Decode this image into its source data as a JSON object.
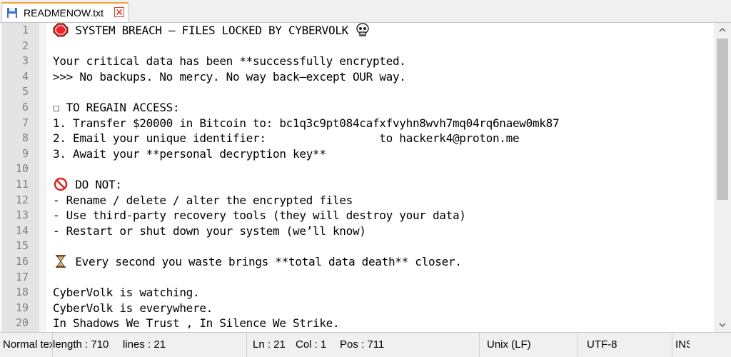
{
  "tab": {
    "filename": "READMENOW.txt",
    "icon": "save-floppy-icon",
    "close_icon": "close-icon"
  },
  "editor": {
    "lines": [
      {
        "n": "1",
        "icon": "stop-sign-icon",
        "text": " SYSTEM BREACH — FILES LOCKED BY CYBERVOLK ",
        "icon_after": "skull-icon"
      },
      {
        "n": "2",
        "text": ""
      },
      {
        "n": "3",
        "text": "Your critical data has been **successfully encrypted."
      },
      {
        "n": "4",
        "text": ">>> No backups. No mercy. No way back—except OUR way."
      },
      {
        "n": "5",
        "text": ""
      },
      {
        "n": "6",
        "text": "☐ TO REGAIN ACCESS:"
      },
      {
        "n": "7",
        "text": "1. Transfer $20000 in Bitcoin to: bc1q3c9pt084cafxfvyhn8wvh7mq04rq6naew0mk87"
      },
      {
        "n": "8",
        "text": "2. Email your unique identifier:                 to hackerk4@proton.me"
      },
      {
        "n": "9",
        "text": "3. Await your **personal decryption key**"
      },
      {
        "n": "10",
        "text": ""
      },
      {
        "n": "11",
        "icon": "prohibited-icon",
        "text": " DO NOT:"
      },
      {
        "n": "12",
        "text": "- Rename / delete / alter the encrypted files"
      },
      {
        "n": "13",
        "text": "- Use third-party recovery tools (they will destroy your data)"
      },
      {
        "n": "14",
        "text": "- Restart or shut down your system (we’ll know)"
      },
      {
        "n": "15",
        "text": ""
      },
      {
        "n": "16",
        "icon": "hourglass-icon",
        "text": " Every second you waste brings **total data death** closer."
      },
      {
        "n": "17",
        "text": ""
      },
      {
        "n": "18",
        "text": "CyberVolk is watching."
      },
      {
        "n": "19",
        "text": "CyberVolk is everywhere."
      },
      {
        "n": "20",
        "text": "In Shadows We Trust , In Silence We Strike."
      }
    ]
  },
  "status": {
    "doc_type": "Normal text file",
    "length": "length : 710",
    "lines": "lines : 21",
    "ln": "Ln : 21",
    "col": "Col : 1",
    "pos": "Pos : 711",
    "eol": "Unix (LF)",
    "encoding": "UTF-8",
    "mode": "INS"
  },
  "colors": {
    "gutter": "#e4e4e4",
    "tab_accent": "#f2a23a",
    "stop": "#e8262a"
  }
}
